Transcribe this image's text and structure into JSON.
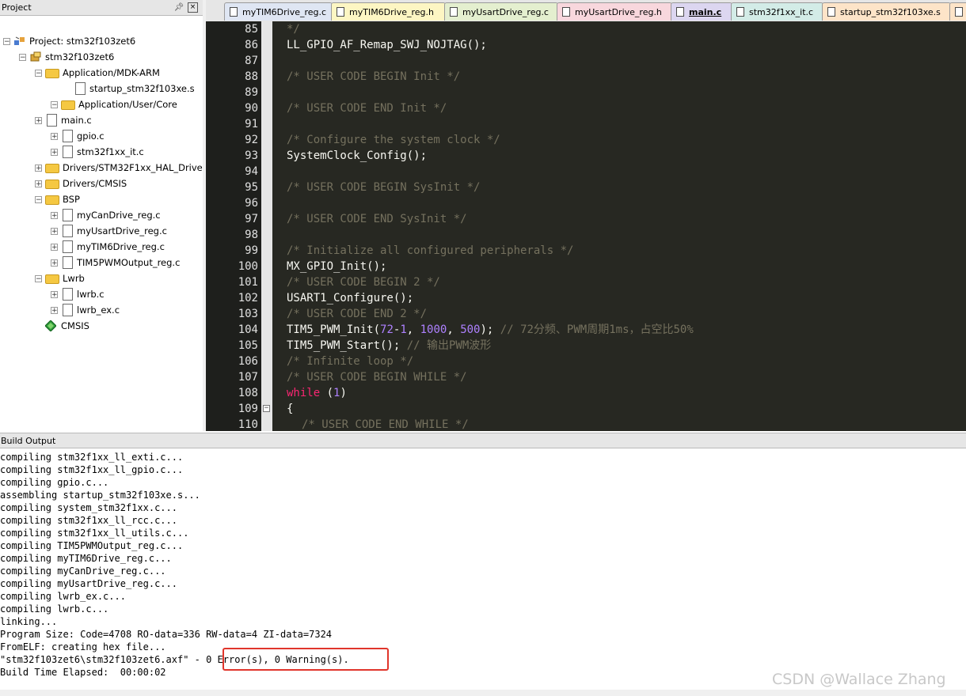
{
  "project": {
    "header": "Project",
    "pin_icon": "pin-icon",
    "close_icon": "close-icon",
    "items": [
      {
        "label": "Project: stm32f103zet6",
        "icon": "project-icon",
        "expander": "-"
      },
      {
        "label": "stm32f103zet6",
        "icon": "target-icon",
        "expander": "-"
      },
      {
        "label": "Application/MDK-ARM",
        "icon": "folder-icon",
        "expander": "-"
      },
      {
        "label": "startup_stm32f103xe.s",
        "icon": "file-icon",
        "expander": ""
      },
      {
        "label": "Application/User/Core",
        "icon": "folder-icon",
        "expander": "-"
      },
      {
        "label": "main.c",
        "icon": "file-icon",
        "expander": "+"
      },
      {
        "label": "gpio.c",
        "icon": "file-icon",
        "expander": "+"
      },
      {
        "label": "stm32f1xx_it.c",
        "icon": "file-icon",
        "expander": "+"
      },
      {
        "label": "Drivers/STM32F1xx_HAL_Driver",
        "icon": "folder-icon",
        "expander": "+"
      },
      {
        "label": "Drivers/CMSIS",
        "icon": "folder-icon",
        "expander": "+"
      },
      {
        "label": "BSP",
        "icon": "folder-icon",
        "expander": "-"
      },
      {
        "label": "myCanDrive_reg.c",
        "icon": "file-icon",
        "expander": "+"
      },
      {
        "label": "myUsartDrive_reg.c",
        "icon": "file-icon",
        "expander": "+"
      },
      {
        "label": "myTIM6Drive_reg.c",
        "icon": "file-icon",
        "expander": "+"
      },
      {
        "label": "TIM5PWMOutput_reg.c",
        "icon": "file-icon",
        "expander": "+"
      },
      {
        "label": "Lwrb",
        "icon": "folder-icon",
        "expander": "-"
      },
      {
        "label": "lwrb.c",
        "icon": "file-icon",
        "expander": "+"
      },
      {
        "label": "lwrb_ex.c",
        "icon": "file-icon",
        "expander": "+"
      },
      {
        "label": "CMSIS",
        "icon": "cmsis-icon",
        "expander": ""
      }
    ]
  },
  "tabs": [
    {
      "label": "myTIM6Drive_reg.c",
      "color": "#dfe6f3"
    },
    {
      "label": "myTIM6Drive_reg.h",
      "color": "#fdf6c3"
    },
    {
      "label": "myUsartDrive_reg.c",
      "color": "#e4efcf"
    },
    {
      "label": "myUsartDrive_reg.h",
      "color": "#f8d7dd"
    },
    {
      "label": "main.c",
      "color": "#dcd6f0"
    },
    {
      "label": "stm32f1xx_it.c",
      "color": "#d3ece7"
    },
    {
      "label": "startup_stm32f103xe.s",
      "color": "#fde4c8"
    },
    {
      "label": "",
      "color": "#fde4c8"
    }
  ],
  "editor": {
    "lines": [
      {
        "n": "85",
        "code": [
          {
            "t": "*/",
            "c": "c-cmt"
          }
        ],
        "indent": 0
      },
      {
        "n": "86",
        "code": [
          {
            "t": "LL_GPIO_AF_Remap_SWJ_NOJTAG();",
            "c": "c-txt"
          }
        ],
        "indent": 0
      },
      {
        "n": "87",
        "code": [],
        "indent": 0
      },
      {
        "n": "88",
        "code": [
          {
            "t": "/* USER CODE BEGIN Init */",
            "c": "c-cmt"
          }
        ],
        "indent": 0
      },
      {
        "n": "89",
        "code": [],
        "indent": 0
      },
      {
        "n": "90",
        "code": [
          {
            "t": "/* USER CODE END Init */",
            "c": "c-cmt"
          }
        ],
        "indent": 0
      },
      {
        "n": "91",
        "code": [],
        "indent": 0
      },
      {
        "n": "92",
        "code": [
          {
            "t": "/* Configure the system clock */",
            "c": "c-cmt"
          }
        ],
        "indent": 0
      },
      {
        "n": "93",
        "code": [
          {
            "t": "SystemClock_Config();",
            "c": "c-txt"
          }
        ],
        "indent": 0
      },
      {
        "n": "94",
        "code": [],
        "indent": 0
      },
      {
        "n": "95",
        "code": [
          {
            "t": "/* USER CODE BEGIN SysInit */",
            "c": "c-cmt"
          }
        ],
        "indent": 0
      },
      {
        "n": "96",
        "code": [],
        "indent": 0
      },
      {
        "n": "97",
        "code": [
          {
            "t": "/* USER CODE END SysInit */",
            "c": "c-cmt"
          }
        ],
        "indent": 0
      },
      {
        "n": "98",
        "code": [],
        "indent": 0
      },
      {
        "n": "99",
        "code": [
          {
            "t": "/* Initialize all configured peripherals */",
            "c": "c-cmt"
          }
        ],
        "indent": 0
      },
      {
        "n": "100",
        "code": [
          {
            "t": "MX_GPIO_Init();",
            "c": "c-txt"
          }
        ],
        "indent": 0
      },
      {
        "n": "101",
        "code": [
          {
            "t": "/* USER CODE BEGIN 2 */",
            "c": "c-cmt"
          }
        ],
        "indent": 0
      },
      {
        "n": "102",
        "code": [
          {
            "t": "USART1_Configure();",
            "c": "c-txt"
          }
        ],
        "indent": 0
      },
      {
        "n": "103",
        "code": [
          {
            "t": "/* USER CODE END 2 */",
            "c": "c-cmt"
          }
        ],
        "indent": 0
      },
      {
        "n": "104",
        "code": [
          {
            "t": "TIM5_PWM_Init(",
            "c": "c-txt"
          },
          {
            "t": "72",
            "c": "c-num"
          },
          {
            "t": "-",
            "c": "c-txt"
          },
          {
            "t": "1",
            "c": "c-num"
          },
          {
            "t": ", ",
            "c": "c-txt"
          },
          {
            "t": "1000",
            "c": "c-num"
          },
          {
            "t": ", ",
            "c": "c-txt"
          },
          {
            "t": "500",
            "c": "c-num"
          },
          {
            "t": "); ",
            "c": "c-txt"
          },
          {
            "t": "// 72分频、PWM周期1ms，占空比50%",
            "c": "c-cmt"
          }
        ],
        "indent": 0
      },
      {
        "n": "105",
        "code": [
          {
            "t": "TIM5_PWM_Start(); ",
            "c": "c-txt"
          },
          {
            "t": "// 输出PWM波形",
            "c": "c-cmt"
          }
        ],
        "indent": 0
      },
      {
        "n": "106",
        "code": [
          {
            "t": "/* Infinite loop */",
            "c": "c-cmt"
          }
        ],
        "indent": 0
      },
      {
        "n": "107",
        "code": [
          {
            "t": "/* USER CODE BEGIN WHILE */",
            "c": "c-cmt"
          }
        ],
        "indent": 0
      },
      {
        "n": "108",
        "code": [
          {
            "t": "while",
            "c": "c-kw"
          },
          {
            "t": " (",
            "c": "c-txt"
          },
          {
            "t": "1",
            "c": "c-num"
          },
          {
            "t": ")",
            "c": "c-txt"
          }
        ],
        "indent": 0
      },
      {
        "n": "109",
        "code": [
          {
            "t": "{",
            "c": "c-txt"
          }
        ],
        "indent": 0,
        "fold": "-"
      },
      {
        "n": "110",
        "code": [
          {
            "t": "/* USER CODE END WHILE */",
            "c": "c-cmt"
          }
        ],
        "indent": 1
      }
    ]
  },
  "build": {
    "header": "Build Output",
    "lines": [
      "compiling stm32f1xx_ll_exti.c...",
      "compiling stm32f1xx_ll_gpio.c...",
      "compiling gpio.c...",
      "assembling startup_stm32f103xe.s...",
      "compiling system_stm32f1xx.c...",
      "compiling stm32f1xx_ll_rcc.c...",
      "compiling stm32f1xx_ll_utils.c...",
      "compiling TIM5PWMOutput_reg.c...",
      "compiling myTIM6Drive_reg.c...",
      "compiling myCanDrive_reg.c...",
      "compiling myUsartDrive_reg.c...",
      "compiling lwrb_ex.c...",
      "compiling lwrb.c...",
      "linking...",
      "Program Size: Code=4708 RO-data=336 RW-data=4 ZI-data=7324",
      "FromELF: creating hex file...",
      "\"stm32f103zet6\\stm32f103zet6.axf\" - 0 Error(s), 0 Warning(s).",
      "Build Time Elapsed:  00:00:02"
    ],
    "highlight_color": "#e0352b"
  },
  "watermark": "CSDN @Wallace Zhang"
}
